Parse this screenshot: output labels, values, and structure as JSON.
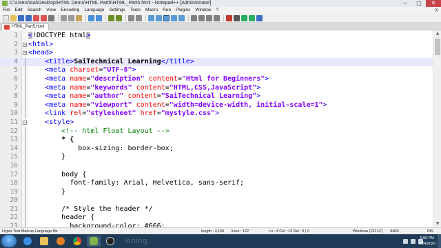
{
  "window": {
    "title": "C:\\Users\\Sai\\Desktop\\HTML Demo\\HTML Part5\\HTML_Part5.html - Notepad++ [Administrator]",
    "min_glyph": "−",
    "max_glyph": "□",
    "close_glyph": "✕"
  },
  "menu": {
    "items": [
      "File",
      "Edit",
      "Search",
      "View",
      "Encoding",
      "Language",
      "Settings",
      "Tools",
      "Macro",
      "Run",
      "Plugins",
      "Window",
      "?"
    ],
    "close_glyph": "X"
  },
  "tabs": [
    {
      "label": "HTML_Part5.html"
    }
  ],
  "editor": {
    "lines": [
      {
        "n": "1",
        "fold": "",
        "tokens": [
          {
            "t": "<",
            "c": "c-hl"
          },
          {
            "t": "!DOCTYPE html",
            "c": "c-doctype"
          },
          {
            "t": ">",
            "c": "c-hl"
          }
        ]
      },
      {
        "n": "2",
        "fold": "minus",
        "tokens": [
          {
            "t": "<html>",
            "c": "c-tag"
          }
        ]
      },
      {
        "n": "3",
        "fold": "minus",
        "tokens": [
          {
            "t": "<head>",
            "c": "c-tag"
          }
        ]
      },
      {
        "n": "4",
        "fold": "line",
        "current": true,
        "tokens": [
          {
            "t": "    ",
            "c": "c-plain"
          },
          {
            "t": "<title>",
            "c": "c-tag"
          },
          {
            "t": "SaiTechnical Learning",
            "c": "c-text"
          },
          {
            "t": "</title>",
            "c": "c-tag"
          }
        ]
      },
      {
        "n": "5",
        "fold": "line",
        "tokens": [
          {
            "t": "    ",
            "c": "c-plain"
          },
          {
            "t": "<meta ",
            "c": "c-tag"
          },
          {
            "t": "charset",
            "c": "c-attr"
          },
          {
            "t": "=",
            "c": "c-plain"
          },
          {
            "t": "\"UTF-8\"",
            "c": "c-str"
          },
          {
            "t": ">",
            "c": "c-tag"
          }
        ]
      },
      {
        "n": "6",
        "fold": "line",
        "tokens": [
          {
            "t": "    ",
            "c": "c-plain"
          },
          {
            "t": "<meta ",
            "c": "c-tag"
          },
          {
            "t": "name",
            "c": "c-attr"
          },
          {
            "t": "=",
            "c": "c-plain"
          },
          {
            "t": "\"description\"",
            "c": "c-str"
          },
          {
            "t": " ",
            "c": "c-plain"
          },
          {
            "t": "content",
            "c": "c-attr"
          },
          {
            "t": "=",
            "c": "c-plain"
          },
          {
            "t": "\"Html for Beginners\"",
            "c": "c-str"
          },
          {
            "t": ">",
            "c": "c-tag"
          }
        ]
      },
      {
        "n": "7",
        "fold": "line",
        "tokens": [
          {
            "t": "    ",
            "c": "c-plain"
          },
          {
            "t": "<meta ",
            "c": "c-tag"
          },
          {
            "t": "name",
            "c": "c-attr"
          },
          {
            "t": "=",
            "c": "c-plain"
          },
          {
            "t": "\"keywords\"",
            "c": "c-str"
          },
          {
            "t": " ",
            "c": "c-plain"
          },
          {
            "t": "content",
            "c": "c-attr"
          },
          {
            "t": "=",
            "c": "c-plain"
          },
          {
            "t": "\"HTML,CSS,JavaScript\"",
            "c": "c-str"
          },
          {
            "t": ">",
            "c": "c-tag"
          }
        ]
      },
      {
        "n": "8",
        "fold": "line",
        "tokens": [
          {
            "t": "    ",
            "c": "c-plain"
          },
          {
            "t": "<meta ",
            "c": "c-tag"
          },
          {
            "t": "name",
            "c": "c-attr"
          },
          {
            "t": "=",
            "c": "c-plain"
          },
          {
            "t": "\"author\"",
            "c": "c-str"
          },
          {
            "t": " ",
            "c": "c-plain"
          },
          {
            "t": "content",
            "c": "c-attr"
          },
          {
            "t": "=",
            "c": "c-plain"
          },
          {
            "t": "\"SaiTechnical Learning\"",
            "c": "c-str"
          },
          {
            "t": ">",
            "c": "c-tag"
          }
        ]
      },
      {
        "n": "9",
        "fold": "line",
        "tokens": [
          {
            "t": "    ",
            "c": "c-plain"
          },
          {
            "t": "<meta ",
            "c": "c-tag"
          },
          {
            "t": "name",
            "c": "c-attr"
          },
          {
            "t": "=",
            "c": "c-plain"
          },
          {
            "t": "\"viewport\"",
            "c": "c-str"
          },
          {
            "t": " ",
            "c": "c-plain"
          },
          {
            "t": "content",
            "c": "c-attr"
          },
          {
            "t": "=",
            "c": "c-plain"
          },
          {
            "t": "\"width=device-width, initial-scale=1\"",
            "c": "c-str"
          },
          {
            "t": ">",
            "c": "c-tag"
          }
        ]
      },
      {
        "n": "10",
        "fold": "line",
        "tokens": [
          {
            "t": "    ",
            "c": "c-plain"
          },
          {
            "t": "<link ",
            "c": "c-tag"
          },
          {
            "t": "rel",
            "c": "c-attr"
          },
          {
            "t": "=",
            "c": "c-plain"
          },
          {
            "t": "\"stylesheet\"",
            "c": "c-str"
          },
          {
            "t": " ",
            "c": "c-plain"
          },
          {
            "t": "href",
            "c": "c-attr"
          },
          {
            "t": "=",
            "c": "c-plain"
          },
          {
            "t": "\"mystyle.css\"",
            "c": "c-str"
          },
          {
            "t": ">",
            "c": "c-tag"
          }
        ]
      },
      {
        "n": "11",
        "fold": "minus",
        "tokens": [
          {
            "t": "    ",
            "c": "c-plain"
          },
          {
            "t": "<style>",
            "c": "c-tag"
          }
        ]
      },
      {
        "n": "12",
        "fold": "line",
        "tokens": [
          {
            "t": "        ",
            "c": "c-plain"
          },
          {
            "t": "<!-- html Float Layout -->",
            "c": "c-comment"
          }
        ]
      },
      {
        "n": "13",
        "fold": "line",
        "tokens": [
          {
            "t": "        ",
            "c": "c-plain"
          },
          {
            "t": "* {",
            "c": "c-text"
          }
        ]
      },
      {
        "n": "14",
        "fold": "line",
        "tokens": [
          {
            "t": "            box-sizing: border-box;",
            "c": "c-plain"
          }
        ]
      },
      {
        "n": "15",
        "fold": "line",
        "tokens": [
          {
            "t": "        }",
            "c": "c-plain"
          }
        ]
      },
      {
        "n": "16",
        "fold": "line",
        "tokens": [
          {
            "t": "",
            "c": "c-plain"
          }
        ]
      },
      {
        "n": "17",
        "fold": "line",
        "tokens": [
          {
            "t": "        body {",
            "c": "c-plain"
          }
        ]
      },
      {
        "n": "18",
        "fold": "line",
        "tokens": [
          {
            "t": "          font-family: Arial, Helvetica, sans-serif;",
            "c": "c-plain"
          }
        ]
      },
      {
        "n": "19",
        "fold": "line",
        "tokens": [
          {
            "t": "        }",
            "c": "c-plain"
          }
        ]
      },
      {
        "n": "20",
        "fold": "line",
        "tokens": [
          {
            "t": "",
            "c": "c-plain"
          }
        ]
      },
      {
        "n": "21",
        "fold": "line",
        "tokens": [
          {
            "t": "        /* Style the header */",
            "c": "c-plain"
          }
        ]
      },
      {
        "n": "22",
        "fold": "line",
        "tokens": [
          {
            "t": "        header {",
            "c": "c-plain"
          }
        ]
      },
      {
        "n": "23",
        "fold": "line",
        "tokens": [
          {
            "t": "          background-color: #666;",
            "c": "c-plain"
          }
        ]
      }
    ]
  },
  "statusbar": {
    "file_type": "Hyper Text Markup Language file",
    "length": "length : 3,159",
    "lines": "lines : 122",
    "position": "Ln : 4    Col : 13    Sel : 0 | 0",
    "eol": "Windows (CR LF)",
    "encoding": "ANSI",
    "mode": "INS"
  },
  "taskbar": {
    "time": "5:56 PM",
    "date": "6/24/2020",
    "watermark": "loning."
  }
}
